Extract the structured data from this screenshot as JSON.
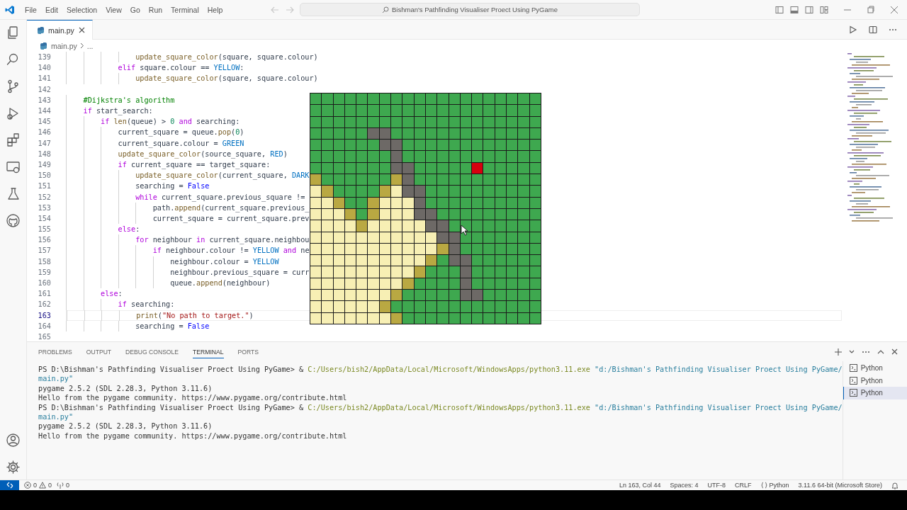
{
  "title_bar": {
    "menus": [
      "File",
      "Edit",
      "Selection",
      "View",
      "Go",
      "Run",
      "Terminal",
      "Help"
    ],
    "search": "Bishman's Pathfinding Visualiser Proect Using PyGame"
  },
  "editor": {
    "tabs": [
      {
        "label": "main.py",
        "selected": true
      }
    ],
    "breadcrumb": [
      "main.py",
      "..."
    ],
    "lines": [
      {
        "number": "139",
        "current": false,
        "tokens": [
          {
            "kind": "fn",
            "text": "                update_square_color"
          },
          {
            "kind": "plain",
            "text": "(square, square.colour)"
          }
        ]
      },
      {
        "number": "140",
        "current": false,
        "tokens": [
          {
            "kind": "kw",
            "text": "            elif"
          },
          {
            "kind": "plain",
            "text": " square.colour == "
          },
          {
            "kind": "const",
            "text": "YELLOW"
          },
          {
            "kind": "plain",
            "text": ":"
          }
        ]
      },
      {
        "number": "141",
        "current": false,
        "tokens": [
          {
            "kind": "fn",
            "text": "                update_square_color"
          },
          {
            "kind": "plain",
            "text": "(square, square.colour)"
          }
        ]
      },
      {
        "number": "142",
        "current": false
      },
      {
        "number": "143",
        "current": false,
        "tokens": [
          {
            "kind": "cmt",
            "text": "    #Dijkstra's algorithm"
          }
        ]
      },
      {
        "number": "144",
        "current": false,
        "tokens": [
          {
            "kind": "kw",
            "text": "    if"
          },
          {
            "kind": "plain",
            "text": " start_search:"
          }
        ]
      },
      {
        "number": "145",
        "current": false,
        "tokens": [
          {
            "kind": "kw",
            "text": "        if"
          },
          {
            "kind": "fn",
            "text": " len"
          },
          {
            "kind": "plain",
            "text": "(queue) > "
          },
          {
            "kind": "num",
            "text": "0"
          },
          {
            "kind": "kw",
            "text": " and"
          },
          {
            "kind": "plain",
            "text": " searching:"
          }
        ]
      },
      {
        "number": "146",
        "current": false,
        "tokens": [
          {
            "kind": "plain",
            "text": "            current_square = queue."
          },
          {
            "kind": "fn",
            "text": "pop"
          },
          {
            "kind": "plain",
            "text": "("
          },
          {
            "kind": "num",
            "text": "0"
          },
          {
            "kind": "plain",
            "text": ")"
          }
        ]
      },
      {
        "number": "147",
        "current": false,
        "tokens": [
          {
            "kind": "plain",
            "text": "            current_square.colour = "
          },
          {
            "kind": "const",
            "text": "GREEN"
          }
        ]
      },
      {
        "number": "148",
        "current": false,
        "tokens": [
          {
            "kind": "fn",
            "text": "            update_square_color"
          },
          {
            "kind": "plain",
            "text": "(source_square, "
          },
          {
            "kind": "const",
            "text": "RED"
          },
          {
            "kind": "plain",
            "text": ")"
          }
        ]
      },
      {
        "number": "149",
        "current": false,
        "tokens": [
          {
            "kind": "kw",
            "text": "            if"
          },
          {
            "kind": "plain",
            "text": " current_square == target_square:"
          }
        ]
      },
      {
        "number": "150",
        "current": false,
        "tokens": [
          {
            "kind": "fn",
            "text": "                update_square_color"
          },
          {
            "kind": "plain",
            "text": "(current_square, "
          },
          {
            "kind": "const",
            "text": "DARK"
          }
        ]
      },
      {
        "number": "151",
        "current": false,
        "tokens": [
          {
            "kind": "plain",
            "text": "                searching = "
          },
          {
            "kind": "bool",
            "text": "False"
          }
        ]
      },
      {
        "number": "152",
        "current": false,
        "tokens": [
          {
            "kind": "kw",
            "text": "                while"
          },
          {
            "kind": "plain",
            "text": " current_square.previous_square !="
          }
        ]
      },
      {
        "number": "153",
        "current": false,
        "tokens": [
          {
            "kind": "plain",
            "text": "                    path."
          },
          {
            "kind": "fn",
            "text": "append"
          },
          {
            "kind": "plain",
            "text": "(current_square.previous_"
          }
        ]
      },
      {
        "number": "154",
        "current": false,
        "tokens": [
          {
            "kind": "plain",
            "text": "                    current_square = current_square.prev"
          }
        ]
      },
      {
        "number": "155",
        "current": false,
        "tokens": [
          {
            "kind": "kw",
            "text": "            else"
          },
          {
            "kind": "plain",
            "text": ":"
          }
        ]
      },
      {
        "number": "156",
        "current": false,
        "tokens": [
          {
            "kind": "kw",
            "text": "                for"
          },
          {
            "kind": "plain",
            "text": " neighbour "
          },
          {
            "kind": "kw",
            "text": "in"
          },
          {
            "kind": "plain",
            "text": " current_square.neighbou"
          }
        ]
      },
      {
        "number": "157",
        "current": false,
        "tokens": [
          {
            "kind": "kw",
            "text": "                    if"
          },
          {
            "kind": "plain",
            "text": " neighbour.colour != "
          },
          {
            "kind": "const",
            "text": "YELLOW"
          },
          {
            "kind": "kw",
            "text": " and"
          },
          {
            "kind": "plain",
            "text": " ne"
          }
        ]
      },
      {
        "number": "158",
        "current": false,
        "tokens": [
          {
            "kind": "plain",
            "text": "                        neighbour.colour = "
          },
          {
            "kind": "const",
            "text": "YELLOW"
          }
        ]
      },
      {
        "number": "159",
        "current": false,
        "tokens": [
          {
            "kind": "plain",
            "text": "                        neighbour.previous_square = curr"
          }
        ]
      },
      {
        "number": "160",
        "current": false,
        "tokens": [
          {
            "kind": "plain",
            "text": "                        queue."
          },
          {
            "kind": "fn",
            "text": "append"
          },
          {
            "kind": "plain",
            "text": "(neighbour)"
          }
        ]
      },
      {
        "number": "161",
        "current": false,
        "tokens": [
          {
            "kind": "kw",
            "text": "        else"
          },
          {
            "kind": "plain",
            "text": ":"
          }
        ]
      },
      {
        "number": "162",
        "current": false,
        "tokens": [
          {
            "kind": "kw",
            "text": "            if"
          },
          {
            "kind": "plain",
            "text": " searching:"
          }
        ]
      },
      {
        "number": "163",
        "current": true,
        "tokens": [
          {
            "kind": "fn",
            "text": "                print"
          },
          {
            "kind": "plain",
            "text": "("
          },
          {
            "kind": "str",
            "text": "\"No path to target.\""
          },
          {
            "kind": "plain",
            "text": ")"
          }
        ]
      },
      {
        "number": "164",
        "current": false,
        "tokens": [
          {
            "kind": "plain",
            "text": "                searching = "
          },
          {
            "kind": "bool",
            "text": "False"
          }
        ]
      },
      {
        "number": "165",
        "current": false
      }
    ]
  },
  "game_window": {
    "rows": [
      [
        {
          "color": "#3ea84f"
        },
        {
          "color": "#3ea84f"
        },
        {
          "color": "#3ea84f"
        },
        {
          "color": "#3ea84f"
        },
        {
          "color": "#3ea84f"
        },
        {
          "color": "#3ea84f"
        },
        {
          "color": "#3ea84f"
        },
        {
          "color": "#3ea84f"
        },
        {
          "color": "#3ea84f"
        },
        {
          "color": "#3ea84f"
        },
        {
          "color": "#3ea84f"
        },
        {
          "color": "#3ea84f"
        },
        {
          "color": "#3ea84f"
        },
        {
          "color": "#3ea84f"
        },
        {
          "color": "#3ea84f"
        },
        {
          "color": "#3ea84f"
        },
        {
          "color": "#3ea84f"
        },
        {
          "color": "#3ea84f"
        },
        {
          "color": "#3ea84f"
        },
        {
          "color": "#3ea84f"
        }
      ],
      [
        {
          "color": "#3ea84f"
        },
        {
          "color": "#3ea84f"
        },
        {
          "color": "#3ea84f"
        },
        {
          "color": "#3ea84f"
        },
        {
          "color": "#3ea84f"
        },
        {
          "color": "#3ea84f"
        },
        {
          "color": "#3ea84f"
        },
        {
          "color": "#3ea84f"
        },
        {
          "color": "#3ea84f"
        },
        {
          "color": "#3ea84f"
        },
        {
          "color": "#3ea84f"
        },
        {
          "color": "#3ea84f"
        },
        {
          "color": "#3ea84f"
        },
        {
          "color": "#3ea84f"
        },
        {
          "color": "#3ea84f"
        },
        {
          "color": "#3ea84f"
        },
        {
          "color": "#3ea84f"
        },
        {
          "color": "#3ea84f"
        },
        {
          "color": "#3ea84f"
        },
        {
          "color": "#3ea84f"
        }
      ],
      [
        {
          "color": "#3ea84f"
        },
        {
          "color": "#3ea84f"
        },
        {
          "color": "#3ea84f"
        },
        {
          "color": "#3ea84f"
        },
        {
          "color": "#3ea84f"
        },
        {
          "color": "#3ea84f"
        },
        {
          "color": "#3ea84f"
        },
        {
          "color": "#3ea84f"
        },
        {
          "color": "#3ea84f"
        },
        {
          "color": "#3ea84f"
        },
        {
          "color": "#3ea84f"
        },
        {
          "color": "#3ea84f"
        },
        {
          "color": "#3ea84f"
        },
        {
          "color": "#3ea84f"
        },
        {
          "color": "#3ea84f"
        },
        {
          "color": "#3ea84f"
        },
        {
          "color": "#3ea84f"
        },
        {
          "color": "#3ea84f"
        },
        {
          "color": "#3ea84f"
        },
        {
          "color": "#3ea84f"
        }
      ],
      [
        {
          "color": "#3ea84f"
        },
        {
          "color": "#3ea84f"
        },
        {
          "color": "#3ea84f"
        },
        {
          "color": "#3ea84f"
        },
        {
          "color": "#3ea84f"
        },
        {
          "color": "#6d6966"
        },
        {
          "color": "#6d6966"
        },
        {
          "color": "#3ea84f"
        },
        {
          "color": "#3ea84f"
        },
        {
          "color": "#3ea84f"
        },
        {
          "color": "#3ea84f"
        },
        {
          "color": "#3ea84f"
        },
        {
          "color": "#3ea84f"
        },
        {
          "color": "#3ea84f"
        },
        {
          "color": "#3ea84f"
        },
        {
          "color": "#3ea84f"
        },
        {
          "color": "#3ea84f"
        },
        {
          "color": "#3ea84f"
        },
        {
          "color": "#3ea84f"
        },
        {
          "color": "#3ea84f"
        }
      ],
      [
        {
          "color": "#3ea84f"
        },
        {
          "color": "#3ea84f"
        },
        {
          "color": "#3ea84f"
        },
        {
          "color": "#3ea84f"
        },
        {
          "color": "#3ea84f"
        },
        {
          "color": "#3ea84f"
        },
        {
          "color": "#6d6966"
        },
        {
          "color": "#6d6966"
        },
        {
          "color": "#3ea84f"
        },
        {
          "color": "#3ea84f"
        },
        {
          "color": "#3ea84f"
        },
        {
          "color": "#3ea84f"
        },
        {
          "color": "#3ea84f"
        },
        {
          "color": "#3ea84f"
        },
        {
          "color": "#3ea84f"
        },
        {
          "color": "#3ea84f"
        },
        {
          "color": "#3ea84f"
        },
        {
          "color": "#3ea84f"
        },
        {
          "color": "#3ea84f"
        },
        {
          "color": "#3ea84f"
        }
      ],
      [
        {
          "color": "#3ea84f"
        },
        {
          "color": "#3ea84f"
        },
        {
          "color": "#3ea84f"
        },
        {
          "color": "#3ea84f"
        },
        {
          "color": "#3ea84f"
        },
        {
          "color": "#3ea84f"
        },
        {
          "color": "#3ea84f"
        },
        {
          "color": "#6d6966"
        },
        {
          "color": "#3ea84f"
        },
        {
          "color": "#3ea84f"
        },
        {
          "color": "#3ea84f"
        },
        {
          "color": "#3ea84f"
        },
        {
          "color": "#3ea84f"
        },
        {
          "color": "#3ea84f"
        },
        {
          "color": "#3ea84f"
        },
        {
          "color": "#3ea84f"
        },
        {
          "color": "#3ea84f"
        },
        {
          "color": "#3ea84f"
        },
        {
          "color": "#3ea84f"
        },
        {
          "color": "#3ea84f"
        }
      ],
      [
        {
          "color": "#3ea84f"
        },
        {
          "color": "#3ea84f"
        },
        {
          "color": "#3ea84f"
        },
        {
          "color": "#3ea84f"
        },
        {
          "color": "#3ea84f"
        },
        {
          "color": "#3ea84f"
        },
        {
          "color": "#3ea84f"
        },
        {
          "color": "#6d6966"
        },
        {
          "color": "#6d6966"
        },
        {
          "color": "#3ea84f"
        },
        {
          "color": "#3ea84f"
        },
        {
          "color": "#3ea84f"
        },
        {
          "color": "#3ea84f"
        },
        {
          "color": "#3ea84f"
        },
        {
          "color": "#d7000f"
        },
        {
          "color": "#3ea84f"
        },
        {
          "color": "#3ea84f"
        },
        {
          "color": "#3ea84f"
        },
        {
          "color": "#3ea84f"
        },
        {
          "color": "#3ea84f"
        }
      ],
      [
        {
          "color": "#b9a842"
        },
        {
          "color": "#3ea84f"
        },
        {
          "color": "#3ea84f"
        },
        {
          "color": "#3ea84f"
        },
        {
          "color": "#3ea84f"
        },
        {
          "color": "#3ea84f"
        },
        {
          "color": "#3ea84f"
        },
        {
          "color": "#b9a842"
        },
        {
          "color": "#6d6966"
        },
        {
          "color": "#3ea84f"
        },
        {
          "color": "#3ea84f"
        },
        {
          "color": "#3ea84f"
        },
        {
          "color": "#3ea84f"
        },
        {
          "color": "#3ea84f"
        },
        {
          "color": "#3ea84f"
        },
        {
          "color": "#3ea84f"
        },
        {
          "color": "#3ea84f"
        },
        {
          "color": "#3ea84f"
        },
        {
          "color": "#3ea84f"
        },
        {
          "color": "#3ea84f"
        }
      ],
      [
        {
          "color": "#f7efb4"
        },
        {
          "color": "#b9a842"
        },
        {
          "color": "#3ea84f"
        },
        {
          "color": "#3ea84f"
        },
        {
          "color": "#3ea84f"
        },
        {
          "color": "#3ea84f"
        },
        {
          "color": "#b9a842"
        },
        {
          "color": "#f7efb4"
        },
        {
          "color": "#6d6966"
        },
        {
          "color": "#6d6966"
        },
        {
          "color": "#3ea84f"
        },
        {
          "color": "#3ea84f"
        },
        {
          "color": "#3ea84f"
        },
        {
          "color": "#3ea84f"
        },
        {
          "color": "#3ea84f"
        },
        {
          "color": "#3ea84f"
        },
        {
          "color": "#3ea84f"
        },
        {
          "color": "#3ea84f"
        },
        {
          "color": "#3ea84f"
        },
        {
          "color": "#3ea84f"
        }
      ],
      [
        {
          "color": "#f7efb4"
        },
        {
          "color": "#f7efb4"
        },
        {
          "color": "#b9a842"
        },
        {
          "color": "#3ea84f"
        },
        {
          "color": "#3ea84f"
        },
        {
          "color": "#b9a842"
        },
        {
          "color": "#f7efb4"
        },
        {
          "color": "#f7efb4"
        },
        {
          "color": "#f7efb4"
        },
        {
          "color": "#6d6966"
        },
        {
          "color": "#3ea84f"
        },
        {
          "color": "#3ea84f"
        },
        {
          "color": "#3ea84f"
        },
        {
          "color": "#3ea84f"
        },
        {
          "color": "#3ea84f"
        },
        {
          "color": "#3ea84f"
        },
        {
          "color": "#3ea84f"
        },
        {
          "color": "#3ea84f"
        },
        {
          "color": "#3ea84f"
        },
        {
          "color": "#3ea84f"
        }
      ],
      [
        {
          "color": "#f7efb4"
        },
        {
          "color": "#f7efb4"
        },
        {
          "color": "#f7efb4"
        },
        {
          "color": "#b9a842"
        },
        {
          "color": "#3ea84f"
        },
        {
          "color": "#b9a842"
        },
        {
          "color": "#f7efb4"
        },
        {
          "color": "#f7efb4"
        },
        {
          "color": "#f7efb4"
        },
        {
          "color": "#6d6966"
        },
        {
          "color": "#6d6966"
        },
        {
          "color": "#3ea84f"
        },
        {
          "color": "#3ea84f"
        },
        {
          "color": "#3ea84f"
        },
        {
          "color": "#3ea84f"
        },
        {
          "color": "#3ea84f"
        },
        {
          "color": "#3ea84f"
        },
        {
          "color": "#3ea84f"
        },
        {
          "color": "#3ea84f"
        },
        {
          "color": "#3ea84f"
        }
      ],
      [
        {
          "color": "#f7efb4"
        },
        {
          "color": "#f7efb4"
        },
        {
          "color": "#f7efb4"
        },
        {
          "color": "#f7efb4"
        },
        {
          "color": "#b9a842"
        },
        {
          "color": "#f7efb4"
        },
        {
          "color": "#f7efb4"
        },
        {
          "color": "#f7efb4"
        },
        {
          "color": "#f7efb4"
        },
        {
          "color": "#f7efb4"
        },
        {
          "color": "#6d6966"
        },
        {
          "color": "#6d6966"
        },
        {
          "color": "#3ea84f"
        },
        {
          "color": "#3ea84f"
        },
        {
          "color": "#3ea84f"
        },
        {
          "color": "#3ea84f"
        },
        {
          "color": "#3ea84f"
        },
        {
          "color": "#3ea84f"
        },
        {
          "color": "#3ea84f"
        },
        {
          "color": "#3ea84f"
        }
      ],
      [
        {
          "color": "#f7efb4"
        },
        {
          "color": "#f7efb4"
        },
        {
          "color": "#f7efb4"
        },
        {
          "color": "#f7efb4"
        },
        {
          "color": "#f7efb4"
        },
        {
          "color": "#f7efb4"
        },
        {
          "color": "#f7efb4"
        },
        {
          "color": "#f7efb4"
        },
        {
          "color": "#f7efb4"
        },
        {
          "color": "#f7efb4"
        },
        {
          "color": "#f7efb4"
        },
        {
          "color": "#6d6966"
        },
        {
          "color": "#6d6966"
        },
        {
          "color": "#3ea84f"
        },
        {
          "color": "#3ea84f"
        },
        {
          "color": "#3ea84f"
        },
        {
          "color": "#3ea84f"
        },
        {
          "color": "#3ea84f"
        },
        {
          "color": "#3ea84f"
        },
        {
          "color": "#3ea84f"
        }
      ],
      [
        {
          "color": "#f7efb4"
        },
        {
          "color": "#f7efb4"
        },
        {
          "color": "#f7efb4"
        },
        {
          "color": "#f7efb4"
        },
        {
          "color": "#f7efb4"
        },
        {
          "color": "#f7efb4"
        },
        {
          "color": "#f7efb4"
        },
        {
          "color": "#f7efb4"
        },
        {
          "color": "#f7efb4"
        },
        {
          "color": "#f7efb4"
        },
        {
          "color": "#f7efb4"
        },
        {
          "color": "#b9a842"
        },
        {
          "color": "#6d6966"
        },
        {
          "color": "#3ea84f"
        },
        {
          "color": "#3ea84f"
        },
        {
          "color": "#3ea84f"
        },
        {
          "color": "#3ea84f"
        },
        {
          "color": "#3ea84f"
        },
        {
          "color": "#3ea84f"
        },
        {
          "color": "#3ea84f"
        }
      ],
      [
        {
          "color": "#f7efb4"
        },
        {
          "color": "#f7efb4"
        },
        {
          "color": "#f7efb4"
        },
        {
          "color": "#f7efb4"
        },
        {
          "color": "#f7efb4"
        },
        {
          "color": "#f7efb4"
        },
        {
          "color": "#f7efb4"
        },
        {
          "color": "#f7efb4"
        },
        {
          "color": "#f7efb4"
        },
        {
          "color": "#f7efb4"
        },
        {
          "color": "#b9a842"
        },
        {
          "color": "#3ea84f"
        },
        {
          "color": "#6d6966"
        },
        {
          "color": "#6d6966"
        },
        {
          "color": "#3ea84f"
        },
        {
          "color": "#3ea84f"
        },
        {
          "color": "#3ea84f"
        },
        {
          "color": "#3ea84f"
        },
        {
          "color": "#3ea84f"
        },
        {
          "color": "#3ea84f"
        }
      ],
      [
        {
          "color": "#f7efb4"
        },
        {
          "color": "#f7efb4"
        },
        {
          "color": "#f7efb4"
        },
        {
          "color": "#f7efb4"
        },
        {
          "color": "#f7efb4"
        },
        {
          "color": "#f7efb4"
        },
        {
          "color": "#f7efb4"
        },
        {
          "color": "#f7efb4"
        },
        {
          "color": "#f7efb4"
        },
        {
          "color": "#b9a842"
        },
        {
          "color": "#3ea84f"
        },
        {
          "color": "#3ea84f"
        },
        {
          "color": "#3ea84f"
        },
        {
          "color": "#6d6966"
        },
        {
          "color": "#3ea84f"
        },
        {
          "color": "#3ea84f"
        },
        {
          "color": "#3ea84f"
        },
        {
          "color": "#3ea84f"
        },
        {
          "color": "#3ea84f"
        },
        {
          "color": "#3ea84f"
        }
      ],
      [
        {
          "color": "#f7efb4"
        },
        {
          "color": "#f7efb4"
        },
        {
          "color": "#f7efb4"
        },
        {
          "color": "#f7efb4"
        },
        {
          "color": "#f7efb4"
        },
        {
          "color": "#f7efb4"
        },
        {
          "color": "#f7efb4"
        },
        {
          "color": "#f7efb4"
        },
        {
          "color": "#b9a842"
        },
        {
          "color": "#3ea84f"
        },
        {
          "color": "#3ea84f"
        },
        {
          "color": "#3ea84f"
        },
        {
          "color": "#3ea84f"
        },
        {
          "color": "#6d6966"
        },
        {
          "color": "#3ea84f"
        },
        {
          "color": "#3ea84f"
        },
        {
          "color": "#3ea84f"
        },
        {
          "color": "#3ea84f"
        },
        {
          "color": "#3ea84f"
        },
        {
          "color": "#3ea84f"
        }
      ],
      [
        {
          "color": "#f7efb4"
        },
        {
          "color": "#f7efb4"
        },
        {
          "color": "#f7efb4"
        },
        {
          "color": "#f7efb4"
        },
        {
          "color": "#f7efb4"
        },
        {
          "color": "#f7efb4"
        },
        {
          "color": "#f7efb4"
        },
        {
          "color": "#b9a842"
        },
        {
          "color": "#3ea84f"
        },
        {
          "color": "#3ea84f"
        },
        {
          "color": "#3ea84f"
        },
        {
          "color": "#3ea84f"
        },
        {
          "color": "#3ea84f"
        },
        {
          "color": "#6d6966"
        },
        {
          "color": "#6d6966"
        },
        {
          "color": "#3ea84f"
        },
        {
          "color": "#3ea84f"
        },
        {
          "color": "#3ea84f"
        },
        {
          "color": "#3ea84f"
        },
        {
          "color": "#3ea84f"
        }
      ],
      [
        {
          "color": "#f7efb4"
        },
        {
          "color": "#f7efb4"
        },
        {
          "color": "#f7efb4"
        },
        {
          "color": "#f7efb4"
        },
        {
          "color": "#f7efb4"
        },
        {
          "color": "#f7efb4"
        },
        {
          "color": "#b9a842"
        },
        {
          "color": "#3ea84f"
        },
        {
          "color": "#3ea84f"
        },
        {
          "color": "#3ea84f"
        },
        {
          "color": "#3ea84f"
        },
        {
          "color": "#3ea84f"
        },
        {
          "color": "#3ea84f"
        },
        {
          "color": "#3ea84f"
        },
        {
          "color": "#3ea84f"
        },
        {
          "color": "#3ea84f"
        },
        {
          "color": "#3ea84f"
        },
        {
          "color": "#3ea84f"
        },
        {
          "color": "#3ea84f"
        },
        {
          "color": "#3ea84f"
        }
      ],
      [
        {
          "color": "#f7efb4"
        },
        {
          "color": "#f7efb4"
        },
        {
          "color": "#f7efb4"
        },
        {
          "color": "#f7efb4"
        },
        {
          "color": "#f7efb4"
        },
        {
          "color": "#f7efb4"
        },
        {
          "color": "#f7efb4"
        },
        {
          "color": "#b9a842"
        },
        {
          "color": "#3ea84f"
        },
        {
          "color": "#3ea84f"
        },
        {
          "color": "#3ea84f"
        },
        {
          "color": "#3ea84f"
        },
        {
          "color": "#3ea84f"
        },
        {
          "color": "#3ea84f"
        },
        {
          "color": "#3ea84f"
        },
        {
          "color": "#3ea84f"
        },
        {
          "color": "#3ea84f"
        },
        {
          "color": "#3ea84f"
        },
        {
          "color": "#3ea84f"
        },
        {
          "color": "#3ea84f"
        }
      ]
    ]
  },
  "panel": {
    "tabs": [
      {
        "label": "PROBLEMS",
        "selected": false
      },
      {
        "label": "OUTPUT",
        "selected": false
      },
      {
        "label": "DEBUG CONSOLE",
        "selected": false
      },
      {
        "label": "TERMINAL",
        "selected": true
      },
      {
        "label": "PORTS",
        "selected": false
      }
    ],
    "terminal_lines": [
      {
        "tokens": [
          {
            "kind": "plain",
            "text": "PS D:\\Bishman's Pathfinding Visualiser Proect Using PyGame> & "
          },
          {
            "kind": "path",
            "text": "C:/Users/bish2/AppData/Local/Microsoft/WindowsApps/python3.11.exe"
          },
          {
            "kind": "str",
            "text": " \"d:/Bishman's Pathfinding Visualiser Proect Using PyGame/"
          }
        ]
      },
      {
        "tokens": [
          {
            "kind": "str",
            "text": "main.py\""
          }
        ]
      },
      {
        "tokens": [
          {
            "kind": "plain",
            "text": "pygame 2.5.2 (SDL 2.28.3, Python 3.11.6)"
          }
        ]
      },
      {
        "tokens": [
          {
            "kind": "plain",
            "text": "Hello from the pygame community. https://www.pygame.org/contribute.html"
          }
        ]
      },
      {
        "tokens": [
          {
            "kind": "plain",
            "text": "PS D:\\Bishman's Pathfinding Visualiser Proect Using PyGame> & "
          },
          {
            "kind": "path",
            "text": "C:/Users/bish2/AppData/Local/Microsoft/WindowsApps/python3.11.exe"
          },
          {
            "kind": "str",
            "text": " \"d:/Bishman's Pathfinding Visualiser Proect Using PyGame/"
          }
        ]
      },
      {
        "tokens": [
          {
            "kind": "str",
            "text": "main.py\""
          }
        ]
      },
      {
        "tokens": [
          {
            "kind": "plain",
            "text": "pygame 2.5.2 (SDL 2.28.3, Python 3.11.6)"
          }
        ]
      },
      {
        "tokens": [
          {
            "kind": "plain",
            "text": "Hello from the pygame community. https://www.pygame.org/contribute.html"
          }
        ]
      }
    ],
    "terminals": [
      {
        "label": "Python",
        "selected": false
      },
      {
        "label": "Python",
        "selected": false
      },
      {
        "label": "Python",
        "selected": true
      }
    ]
  },
  "status_bar": {
    "errors": "0",
    "warnings": "0",
    "ports": "0",
    "items": [
      {
        "kind": "text",
        "text": "Ln 163, Col 44"
      },
      {
        "kind": "text",
        "text": "Spaces: 4"
      },
      {
        "kind": "text",
        "text": "UTF-8"
      },
      {
        "kind": "text",
        "text": "CRLF"
      },
      {
        "kind": "language",
        "text": "Python"
      },
      {
        "kind": "text",
        "text": "3.11.6 64-bit (Microsoft Store)"
      }
    ]
  }
}
